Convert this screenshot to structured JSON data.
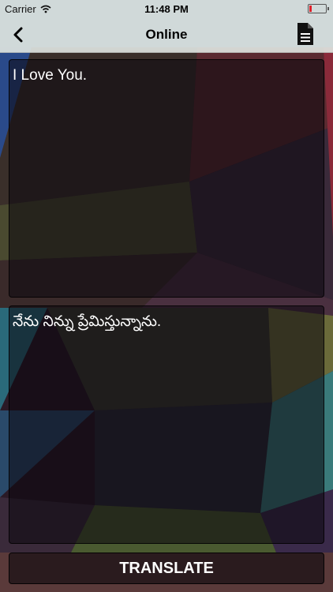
{
  "status": {
    "carrier": "Carrier",
    "time": "11:48 PM",
    "battery_level": 0.15
  },
  "nav": {
    "title": "Online"
  },
  "input": {
    "text": "I Love You."
  },
  "output": {
    "text": "నేను నిన్ను ప్రేమిస్తున్నాను."
  },
  "actions": {
    "translate_label": "TRANSLATE"
  },
  "colors": {
    "accent": "#ffffff",
    "battery_low": "#e0202a",
    "bar_bg": "#dee4e0"
  }
}
